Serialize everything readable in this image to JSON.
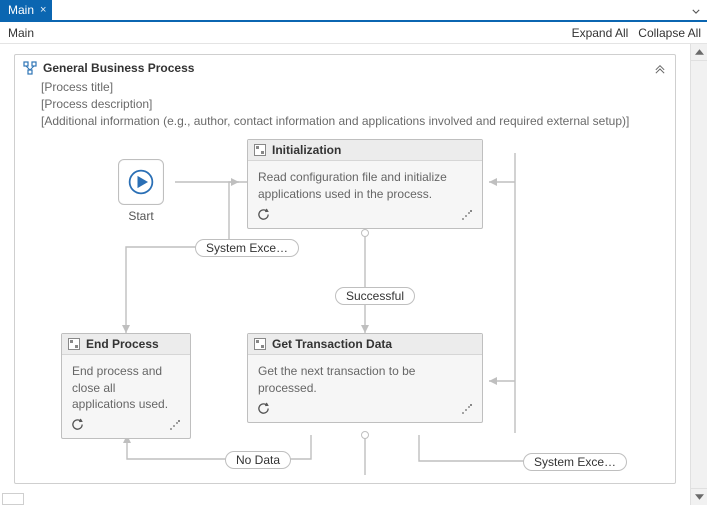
{
  "tabs": {
    "main": "Main",
    "close": "×"
  },
  "breadcrumb": {
    "root": "Main"
  },
  "actions": {
    "expand_all": "Expand All",
    "collapse_all": "Collapse All"
  },
  "container": {
    "title": "General Business Process",
    "meta1": "[Process title]",
    "meta2": "[Process description]",
    "meta3": "[Additional information (e.g., author, contact information and applications involved and required external setup)]"
  },
  "nodes": {
    "start": "Start",
    "init": {
      "title": "Initialization",
      "desc": "Read configuration file and initialize applications used in the process."
    },
    "get_txn": {
      "title": "Get Transaction Data",
      "desc": "Get the next transaction to be processed."
    },
    "end": {
      "title": "End Process",
      "desc": "End process and close all applications used."
    }
  },
  "edges": {
    "system_exc": "System Exce…",
    "successful": "Successful",
    "no_data": "No Data",
    "system_exc2": "System Exce…"
  }
}
